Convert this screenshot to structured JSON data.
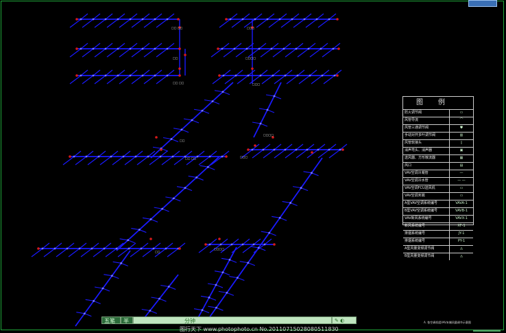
{
  "legend": {
    "title": "图例",
    "rows": [
      {
        "label": "防火调节阀",
        "symbol": "▭"
      },
      {
        "label": "风管导流",
        "symbol": "⌒"
      },
      {
        "label": "风管三通调节阀",
        "symbol": "⛊"
      },
      {
        "label": "手动对开多叶调节阀",
        "symbol": "▥"
      },
      {
        "label": "风管软接头",
        "symbol": "▯"
      },
      {
        "label": "消声弯头、消声器",
        "symbol": "▣"
      },
      {
        "label": "送风器、方形散流器",
        "symbol": "▦"
      },
      {
        "label": "风口",
        "symbol": "▤"
      },
      {
        "label": "VAV空调冷凝管",
        "symbol": "—"
      },
      {
        "label": "VAV空调冷水管",
        "symbol": "— —"
      },
      {
        "label": "VAV空调FCU送风机",
        "symbol": "▭"
      },
      {
        "label": "VAV空调末端",
        "symbol": "▭"
      },
      {
        "label": "A型VAV空调系统编号",
        "symbol": "VAVA-1"
      },
      {
        "label": "B型VAV空调系统编号",
        "symbol": "VAVB-1"
      },
      {
        "label": "VAV新风系统编号",
        "symbol": "VAVX-1"
      },
      {
        "label": "新风系统编号",
        "symbol": "XF-1"
      },
      {
        "label": "排烟系统编号",
        "symbol": "JY-1"
      },
      {
        "label": "排烟系统编号",
        "symbol": "PY-1"
      },
      {
        "label": "A型风量变频调节阀",
        "symbol": "◬"
      },
      {
        "label": "B型风量变频调节阀",
        "symbol": "◬"
      }
    ]
  },
  "statusbar": {
    "ime_name": "五笔",
    "ime_mode": "半",
    "unit": "分钟",
    "icons": "✎ ◐"
  },
  "watermark": "图行天下 www.photophoto.cn   No.20110715028080511830",
  "footnote": "A. 各空调机组VAV末端风量调节示意图",
  "annotations": {
    "box_label": "□ □ □ □",
    "small_labels": [
      "□□ □□",
      "□□□",
      "□□",
      "□□□□"
    ]
  },
  "colors": {
    "duct": "#1a1aff",
    "fitting": "#d91a1a",
    "frame": "#1fa83a",
    "background": "#000000"
  }
}
